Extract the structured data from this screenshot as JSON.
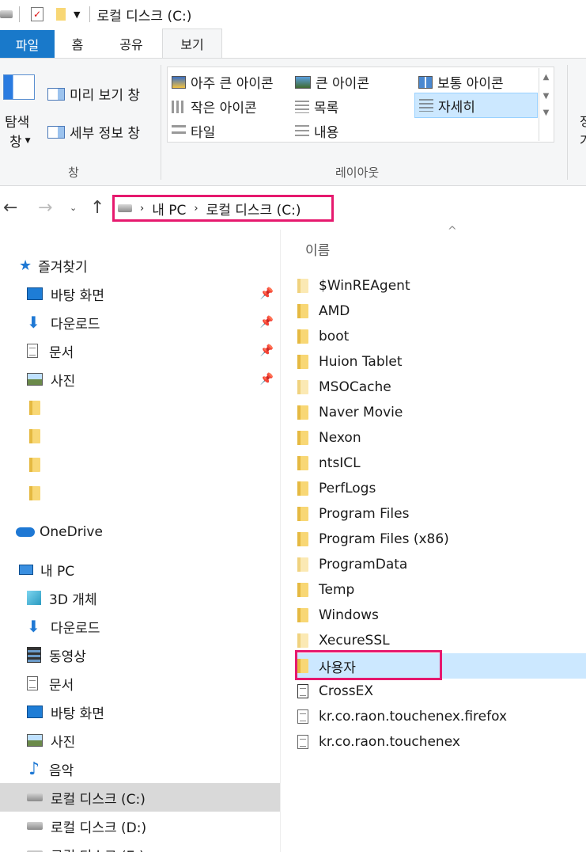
{
  "window": {
    "title": "로컬 디스크 (C:)"
  },
  "ribbon": {
    "tabs": [
      {
        "label": "파일"
      },
      {
        "label": "홈"
      },
      {
        "label": "공유"
      },
      {
        "label": "보기"
      }
    ],
    "pane_group": {
      "nav_pane_label_1": "탐색",
      "nav_pane_label_2": "창",
      "preview_pane": "미리 보기 창",
      "details_pane": "세부 정보 창",
      "group_label": "창"
    },
    "layout_group": {
      "extra_large_icons": "아주 큰 아이콘",
      "large_icons": "큰 아이콘",
      "medium_icons": "보통 아이콘",
      "small_icons": "작은 아이콘",
      "list": "목록",
      "details": "자세히",
      "tiles": "타일",
      "content": "내용",
      "group_label": "레이아웃"
    },
    "partial_group": {
      "label_1": "정",
      "label_2": "가"
    }
  },
  "address": {
    "crumbs": [
      "내 PC",
      "로컬 디스크 (C:)"
    ]
  },
  "nav": {
    "quick_access": "즐겨찾기",
    "quick_items": [
      "바탕 화면",
      "다운로드",
      "문서",
      "사진"
    ],
    "onedrive": "OneDrive",
    "this_pc": "내 PC",
    "pc_items": [
      "3D 개체",
      "다운로드",
      "동영상",
      "문서",
      "바탕 화면",
      "사진",
      "음악",
      "로컬 디스크 (C:)",
      "로컬 디스크 (D:)",
      "로컬 디스크 (E:)"
    ]
  },
  "files": {
    "column_name": "이름",
    "items": [
      {
        "name": "$WinREAgent",
        "type": "folder-pale"
      },
      {
        "name": "AMD",
        "type": "folder"
      },
      {
        "name": "boot",
        "type": "folder"
      },
      {
        "name": "Huion Tablet",
        "type": "folder"
      },
      {
        "name": "MSOCache",
        "type": "folder-pale"
      },
      {
        "name": "Naver Movie",
        "type": "folder"
      },
      {
        "name": "Nexon",
        "type": "folder"
      },
      {
        "name": "ntsICL",
        "type": "folder"
      },
      {
        "name": "PerfLogs",
        "type": "folder"
      },
      {
        "name": "Program Files",
        "type": "folder"
      },
      {
        "name": "Program Files (x86)",
        "type": "folder"
      },
      {
        "name": "ProgramData",
        "type": "folder-pale"
      },
      {
        "name": "Temp",
        "type": "folder"
      },
      {
        "name": "Windows",
        "type": "folder"
      },
      {
        "name": "XecureSSL",
        "type": "folder-pale"
      },
      {
        "name": "사용자",
        "type": "folder"
      },
      {
        "name": "CrossEX",
        "type": "shortcut"
      },
      {
        "name": "kr.co.raon.touchenex.firefox",
        "type": "file"
      },
      {
        "name": "kr.co.raon.touchenex",
        "type": "file"
      }
    ]
  },
  "colors": {
    "accent": "#1979ca",
    "highlight_box": "#e6196e",
    "selection": "#cce8ff"
  }
}
